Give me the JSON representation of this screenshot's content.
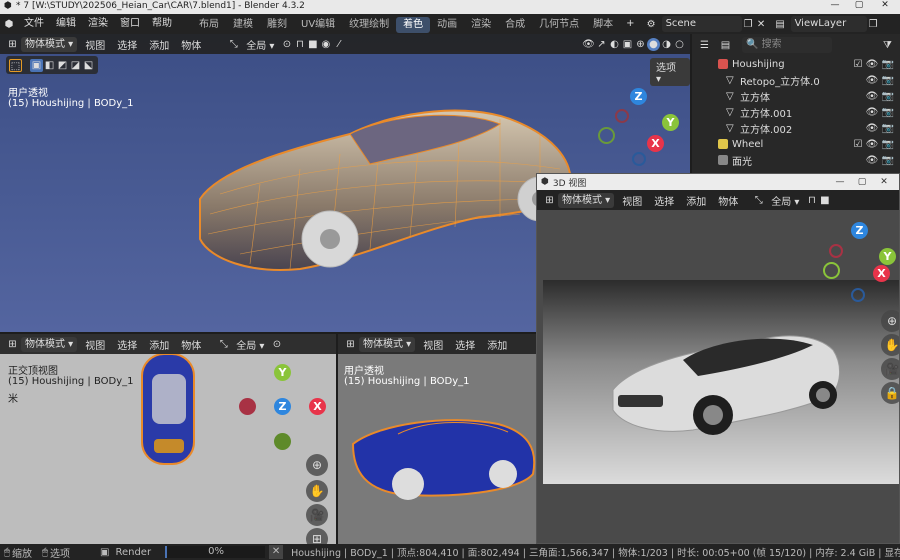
{
  "window": {
    "title": "* 7 [W:\\STUDY\\202506_Heian_Car\\CAR\\7.blend1] - Blender 4.3.2"
  },
  "topbar": {
    "menus": [
      "文件",
      "编辑",
      "渲染",
      "窗口",
      "帮助"
    ],
    "workspaces": [
      "布局",
      "建模",
      "雕刻",
      "UV编辑",
      "纹理绘制",
      "着色",
      "动画",
      "渲染",
      "合成",
      "几何节点",
      "脚本"
    ],
    "active_workspace": "着色",
    "add_tab": "+",
    "scene": "Scene",
    "viewlayer": "ViewLayer"
  },
  "main_view": {
    "mode": "物体模式",
    "menus": [
      "视图",
      "选择",
      "添加",
      "物体"
    ],
    "orientation": "全局",
    "options": "选项",
    "view_name": "用户透视",
    "object_info": "(15) Houshijing | BODy_1"
  },
  "outliner": {
    "search_placeholder": "搜索",
    "rows": [
      {
        "label": "Houshijing",
        "color": "#d9534f"
      },
      {
        "label": "Retopo_立方体.0",
        "color": "#dddddd"
      },
      {
        "label": "立方体",
        "color": "#dddddd"
      },
      {
        "label": "立方体.001",
        "color": "#dddddd"
      },
      {
        "label": "立方体.002",
        "color": "#dddddd"
      },
      {
        "label": "Wheel",
        "color": "#e0c64a"
      },
      {
        "label": "面光",
        "color": "#dddddd"
      }
    ]
  },
  "float_window": {
    "title": "3D 视图",
    "mode": "物体模式",
    "menus": [
      "视图",
      "选择",
      "添加",
      "物体"
    ],
    "orientation": "全局"
  },
  "bl_view": {
    "mode": "物体模式",
    "menus": [
      "视图",
      "选择",
      "添加",
      "物体"
    ],
    "orientation": "全局",
    "view_name": "正交顶视图",
    "object_info": "(15) Houshijing | BODy_1",
    "extra": "米"
  },
  "bm_view": {
    "mode": "物体模式",
    "menus": [
      "视图",
      "选择",
      "添加"
    ],
    "view_name": "用户透视",
    "object_info": "(15) Houshijing | BODy_1"
  },
  "gizmo": {
    "x": "X",
    "y": "Y",
    "z": "Z",
    "x_color": "#e8344a",
    "y_color": "#8ac43a",
    "z_color": "#2e86de"
  },
  "statusbar": {
    "zoom": "缩放",
    "select": "选项",
    "render": "Render",
    "progress": "0%",
    "stats": "Houshijing | BODy_1 | 顶点:804,410 | 面:802,494 | 三角面:1,566,347 | 物体:1/203 | 时长: 00:05+00 (帧 15/120) | 内存: 2.4 GiB | 显存: 5.4/16.0"
  }
}
